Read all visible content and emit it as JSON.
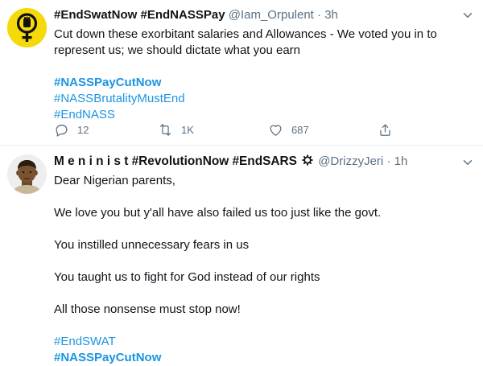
{
  "tweets": [
    {
      "name": "#EndSwatNow #EndNASSPay",
      "handle": "@Iam_Orpulent",
      "separator": "·",
      "time": "3h",
      "text_lines": [
        "Cut down these exorbitant salaries and Allowances - We voted you in to",
        "represent us; we should dictate what you earn"
      ],
      "hashtags": [
        "#NASSPayCutNow",
        "#NASSBrutalityMustEnd",
        "#EndNASS"
      ],
      "actions": {
        "reply_count": "12",
        "retweet_count": "1K",
        "like_count": "687"
      }
    },
    {
      "name": "M e n i n i s t #RevolutionNow #EndSARS",
      "handle": "@DrizzyJeri",
      "separator": "·",
      "time": "1h",
      "text_lines": [
        "Dear Nigerian parents,",
        "We love you but y'all have also failed us too just like the govt.",
        "You instilled unnecessary fears in us",
        "You taught us to fight for God instead of our rights",
        "All those nonsense must stop now!"
      ],
      "hashtags": [
        "#EndSWAT",
        "#NASSPayCutNow"
      ]
    }
  ],
  "colors": {
    "link": "#1b95e0",
    "muted": "#5b7083",
    "avatar1_bg": "#f5d90a"
  }
}
